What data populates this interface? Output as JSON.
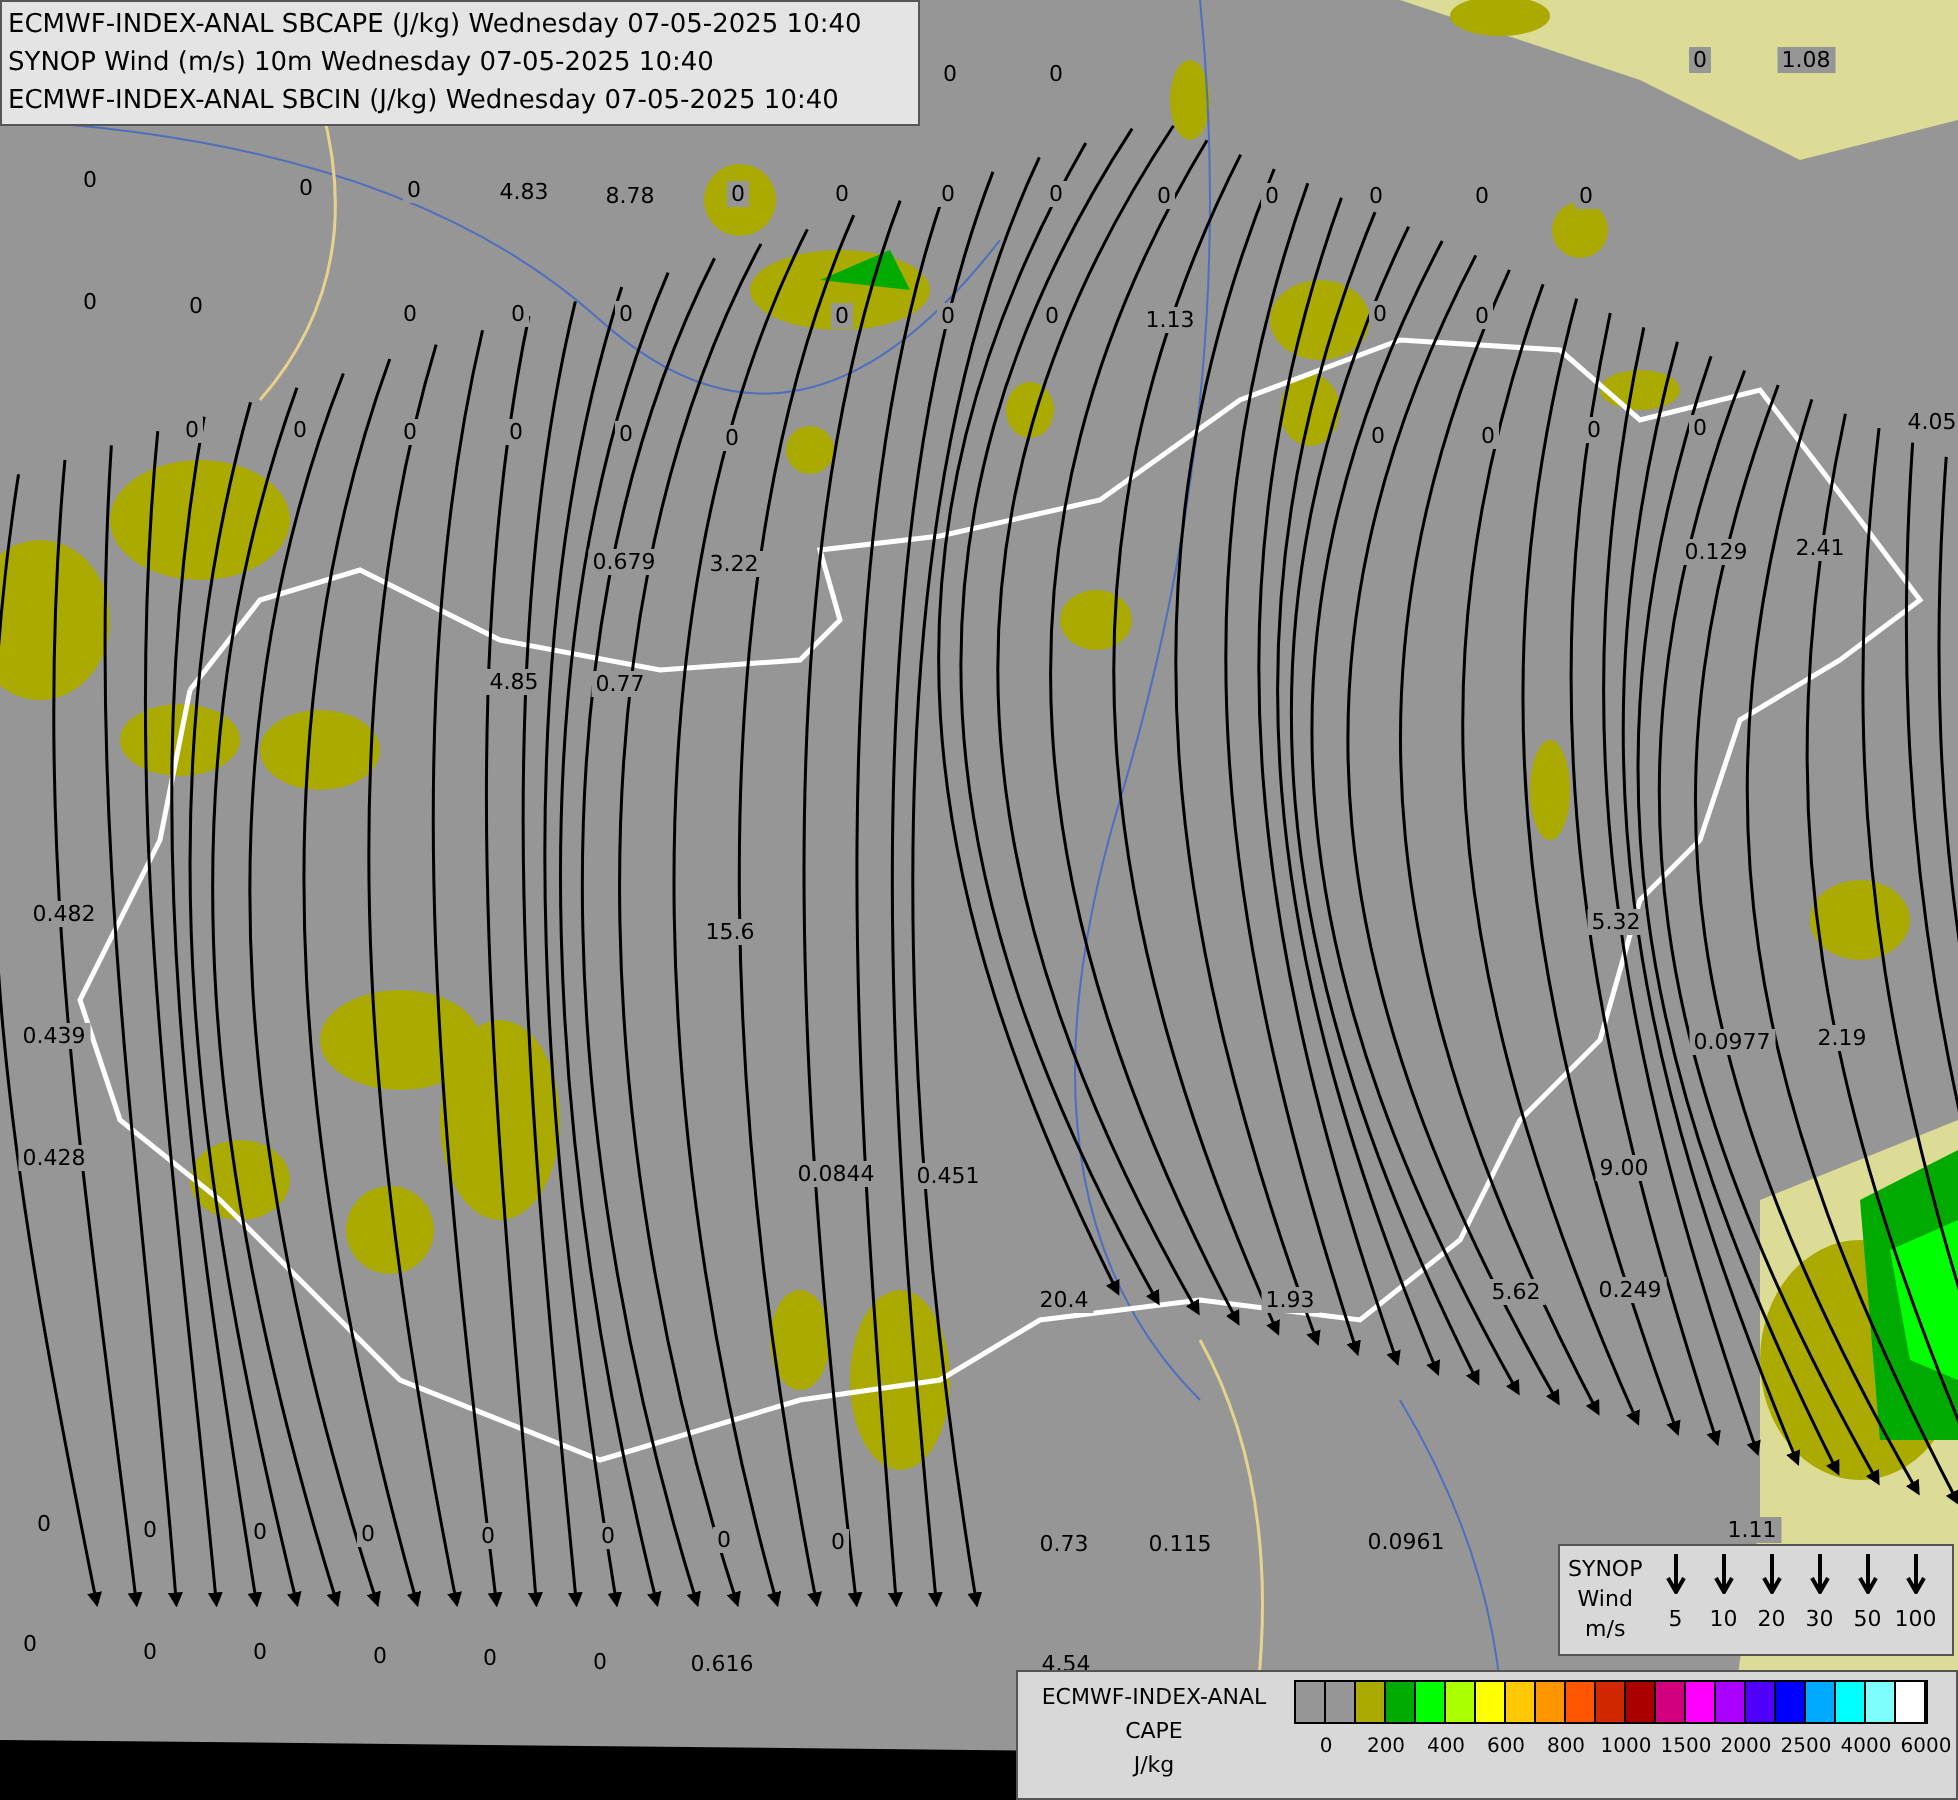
{
  "titles": [
    "ECMWF-INDEX-ANAL SBCAPE (J/kg) Wednesday 07-05-2025 10:40",
    "SYNOP Wind (m/s) 10m Wednesday 07-05-2025 10:40",
    "ECMWF-INDEX-ANAL SBCIN (J/kg) Wednesday 07-05-2025 10:40"
  ],
  "map_values": [
    "0",
    "0",
    "0",
    "1.08",
    "0",
    "0",
    "0",
    "4.83",
    "8.78",
    "0",
    "0",
    "0",
    "0",
    "0",
    "0",
    "0",
    "0",
    "0",
    "0",
    "0",
    "0",
    "0",
    "0",
    "0",
    "0",
    "0",
    "1.13",
    "0",
    "0",
    "0",
    "0",
    "0",
    "0",
    "0",
    "0",
    "0",
    "0",
    "0",
    "0",
    "4.05",
    "0.679",
    "3.22",
    "0.129",
    "2.41",
    "4.85",
    "0.77",
    "0.482",
    "15.6",
    "5.32",
    "0.439",
    "0.0977",
    "2.19",
    "0.428",
    "0.0844",
    "0.451",
    "9.00",
    "20.4",
    "1.93",
    "5.62",
    "0.249",
    "0",
    "0",
    "0",
    "0",
    "0",
    "0",
    "0",
    "0",
    "0.73",
    "0.115",
    "0.0961",
    "1.11",
    "0",
    "0",
    "0",
    "0",
    "0",
    "0",
    "0.616",
    "4.54"
  ],
  "wind_legend": {
    "labels": [
      "SYNOP",
      "Wind",
      "m/s"
    ],
    "speeds": [
      "5",
      "10",
      "20",
      "30",
      "50",
      "100"
    ]
  },
  "cape_legend": {
    "labels": [
      "ECMWF-INDEX-ANAL",
      "CAPE",
      "J/kg"
    ],
    "swatches": [
      {
        "color": "#969696"
      },
      {
        "color": "#969696"
      },
      {
        "color": "#aaaa00"
      },
      {
        "color": "#00aa00"
      },
      {
        "color": "#00ff00"
      },
      {
        "color": "#aaff00"
      },
      {
        "color": "#ffff00"
      },
      {
        "color": "#ffc800"
      },
      {
        "color": "#ff9600"
      },
      {
        "color": "#ff5500"
      },
      {
        "color": "#d22800"
      },
      {
        "color": "#aa0000"
      },
      {
        "color": "#d2007d"
      },
      {
        "color": "#ff00ff"
      },
      {
        "color": "#aa00ff"
      },
      {
        "color": "#5000ff"
      },
      {
        "color": "#0000ff"
      },
      {
        "color": "#00aaff"
      },
      {
        "color": "#00ffff"
      },
      {
        "color": "#80ffff"
      },
      {
        "color": "#ffffff"
      }
    ],
    "ticks": [
      "0",
      "200",
      "400",
      "600",
      "800",
      "1000",
      "1500",
      "2000",
      "2500",
      "4000",
      "6000"
    ]
  }
}
